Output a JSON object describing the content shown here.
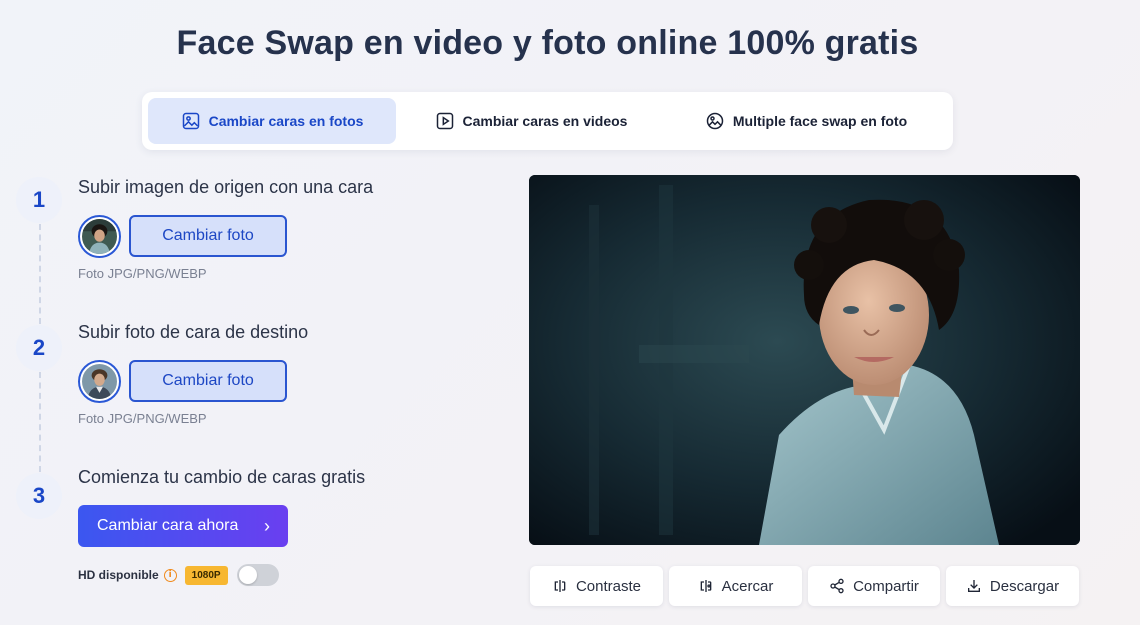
{
  "page": {
    "title": "Face Swap en video y foto online 100% gratis"
  },
  "tabs": [
    {
      "label": "Cambiar caras en fotos",
      "icon": "image-icon",
      "active": true
    },
    {
      "label": "Cambiar caras en videos",
      "icon": "video-play-icon",
      "active": false
    },
    {
      "label": "Multiple face swap en foto",
      "icon": "multi-face-image-icon",
      "active": false
    }
  ],
  "steps": [
    {
      "number": "1",
      "title": "Subir imagen de origen con una cara",
      "button": "Cambiar foto",
      "hint": "Foto JPG/PNG/WEBP"
    },
    {
      "number": "2",
      "title": "Subir foto de cara de destino",
      "button": "Cambiar foto",
      "hint": "Foto JPG/PNG/WEBP"
    },
    {
      "number": "3",
      "title": "Comienza tu cambio de caras gratis",
      "button": "Cambiar cara ahora"
    }
  ],
  "hd": {
    "label": "HD disponible",
    "badge": "1080P",
    "enabled": false
  },
  "actions": [
    {
      "label": "Contraste",
      "icon": "compare-icon"
    },
    {
      "label": "Acercar",
      "icon": "zoom-compare-icon"
    },
    {
      "label": "Compartir",
      "icon": "share-icon"
    },
    {
      "label": "Descargar",
      "icon": "download-icon"
    }
  ],
  "colors": {
    "accent": "#1a47c7",
    "gradient_start": "#3b57f0",
    "gradient_end": "#6a3ff0",
    "badge": "#f7b731"
  }
}
